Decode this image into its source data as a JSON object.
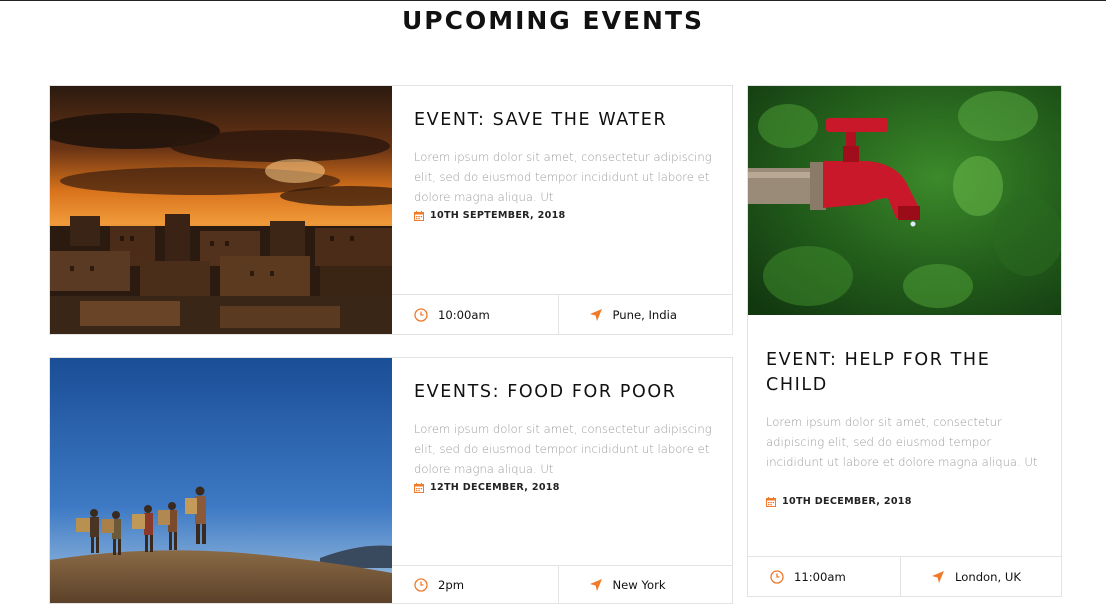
{
  "section": {
    "title": "UPCOMING EVENTS"
  },
  "colors": {
    "accent": "#f07a2c",
    "title": "#111111",
    "muted": "#9c9c9c",
    "border": "#e3e3e3"
  },
  "events": [
    {
      "title": "EVENT: SAVE THE WATER",
      "description": "Lorem ipsum dolor sit amet, consectetur adipiscing elit, sed do eiusmod tempor incididunt ut labore et dolore magna aliqua. Ut",
      "date": "10TH SEPTEMBER, 2018",
      "time": "10:00am",
      "location": "Pune, India",
      "image": "sunset-city-photo"
    },
    {
      "title": "EVENTS: FOOD FOR POOR",
      "description": "Lorem ipsum dolor sit amet, consectetur adipiscing elit, sed do eiusmod tempor incididunt ut labore et dolore magna aliqua. Ut",
      "date": "12TH DECEMBER, 2018",
      "time": "2pm",
      "location": "New York",
      "image": "people-carrying-baskets-photo"
    },
    {
      "title": "EVENT: HELP FOR THE CHILD",
      "description": "Lorem ipsum dolor sit amet, consectetur adipiscing elit, sed do eiusmod tempor incididunt ut labore et dolore magna aliqua. Ut",
      "date": "10TH DECEMBER, 2018",
      "time": "11:00am",
      "location": "London, UK",
      "image": "red-water-tap-photo"
    }
  ],
  "icons": {
    "date": "calendar-icon",
    "time": "clock-icon",
    "location": "location-arrow-icon"
  }
}
